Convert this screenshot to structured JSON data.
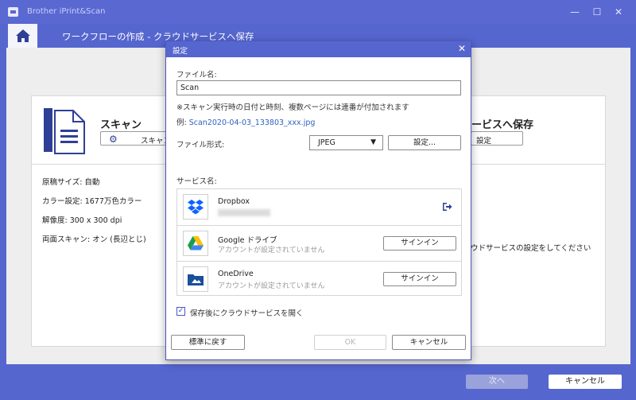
{
  "window": {
    "title": "Brother iPrint&Scan",
    "minimize": "—",
    "maximize": "☐",
    "close": "✕"
  },
  "header": {
    "title": "ワークフローの作成 - クラウドサービスへ保存"
  },
  "scan_panel": {
    "heading": "スキャン",
    "settings_button": "スキャン設定",
    "info": [
      "原稿サイズ: 自動",
      "カラー設定: 1677万色カラー",
      "解像度: 300 x 300 dpi",
      "両面スキャン: オン (長辺とじ)"
    ]
  },
  "save_panel": {
    "heading": "ービスへ保存",
    "settings_button": "設定",
    "message": "ウドサービスの設定をしてください"
  },
  "footer": {
    "next": "次へ",
    "cancel": "キャンセル"
  },
  "dialog": {
    "title": "設定",
    "close": "✕",
    "filename_label": "ファイル名:",
    "filename_value": "Scan",
    "note": "※スキャン実行時の日付と時刻、複数ページには連番が付加されます",
    "example_prefix": "例: ",
    "example_value": "Scan2020-04-03_133803_xxx.jpg",
    "format_label": "ファイル形式:",
    "format_value": "JPEG",
    "format_settings": "設定...",
    "service_label": "サービス名:",
    "services": [
      {
        "name": "Dropbox",
        "icon": "dropbox-icon"
      },
      {
        "name": "Google ドライブ",
        "status": "アカウントが設定されていません",
        "button": "サインイン",
        "icon": "google-drive-icon"
      },
      {
        "name": "OneDrive",
        "status": "アカウントが設定されていません",
        "button": "サインイン",
        "icon": "onedrive-icon"
      }
    ],
    "open_after_save": "保存後にクラウドサービスを開く",
    "open_after_save_checked": true,
    "reset_button": "標準に戻す",
    "ok_button": "OK",
    "cancel_button": "キャンセル"
  },
  "colors": {
    "accent": "#5666cf",
    "link": "#2f63c0",
    "disabled_text": "#9a9a9a"
  }
}
